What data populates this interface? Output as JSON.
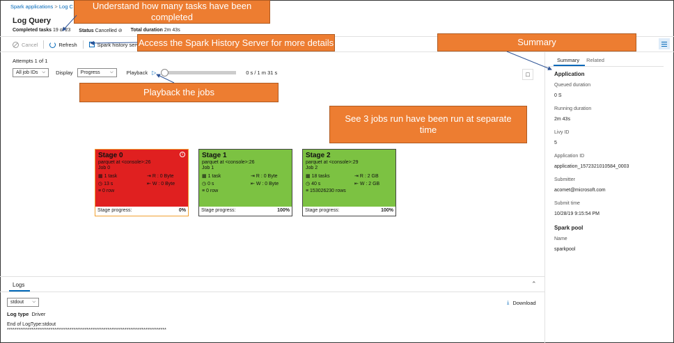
{
  "breadcrumb": {
    "root": "Spark applications",
    "sep": ">",
    "current": "Log C"
  },
  "page_title": "Log Query",
  "stats": {
    "completed_label": "Completed tasks",
    "completed_value": "19 of 23",
    "status_label": "Status",
    "status_value": "Cancelled",
    "duration_label": "Total duration",
    "duration_value": "2m 43s"
  },
  "toolbar": {
    "cancel": "Cancel",
    "refresh": "Refresh",
    "history": "Spark history server"
  },
  "attempts": "Attempts 1 of 1",
  "controls": {
    "job_select": "All job IDs",
    "display_label": "Display",
    "display_select": "Progress",
    "playback_label": "Playback",
    "time": "0 s / 1 m 31 s"
  },
  "stages": [
    {
      "name": "Stage 0",
      "op": "parquet at <console>:26",
      "job": "Job 0",
      "tasks": "1 task",
      "read": "R : 0 Byte",
      "time": "13 s",
      "write": "W : 0 Byte",
      "rows": "0 row",
      "progress_label": "Stage progress:",
      "progress": "0%",
      "color": "#e02020"
    },
    {
      "name": "Stage 1",
      "op": "parquet at <console>:26",
      "job": "Job 1",
      "tasks": "1 task",
      "read": "R : 0 Byte",
      "time": "0 s",
      "write": "W : 0 Byte",
      "rows": "0 row",
      "progress_label": "Stage progress:",
      "progress": "100%",
      "color": "#7cc242"
    },
    {
      "name": "Stage 2",
      "op": "parquet at <console>:29",
      "job": "Job 2",
      "tasks": "18 tasks",
      "read": "R : 2 GB",
      "time": "40 s",
      "write": "W : 2 GB",
      "rows": "153026230 rows",
      "progress_label": "Stage progress:",
      "progress": "100%",
      "color": "#7cc242"
    }
  ],
  "logs": {
    "tab": "Logs",
    "stream": "stdout",
    "download": "Download",
    "logtype_label": "Log type",
    "logtype_value": "Driver",
    "end": "End of LogType:stdout",
    "rule": "************************************************************************************"
  },
  "side_tabs": {
    "summary": "Summary",
    "related": "Related"
  },
  "summary": {
    "heading": "Application",
    "queued_label": "Queued duration",
    "queued_value": "0 S",
    "running_label": "Running duration",
    "running_value": "2m 43s",
    "livy_label": "Livy ID",
    "livy_value": "5",
    "appid_label": "Application ID",
    "appid_value": "application_1572321010584_0003",
    "submitter_label": "Submitter",
    "submitter_value": "acomet@microsoft.com",
    "submit_label": "Submit time",
    "submit_value": "10/28/19 9:15:54 PM",
    "pool_heading": "Spark pool",
    "name_label": "Name",
    "name_value": "sparkpool"
  },
  "callouts": {
    "tasks": "Understand how many tasks have been completed",
    "history": "Access the Spark History Server for more details",
    "summary": "Summary",
    "playback": "Playback the jobs",
    "jobs": "See 3 jobs run have been run at separate time"
  },
  "colors": {
    "accent": "#0067b8",
    "callout": "#ed7d31",
    "failed": "#e02020",
    "succeeded": "#7cc242"
  }
}
